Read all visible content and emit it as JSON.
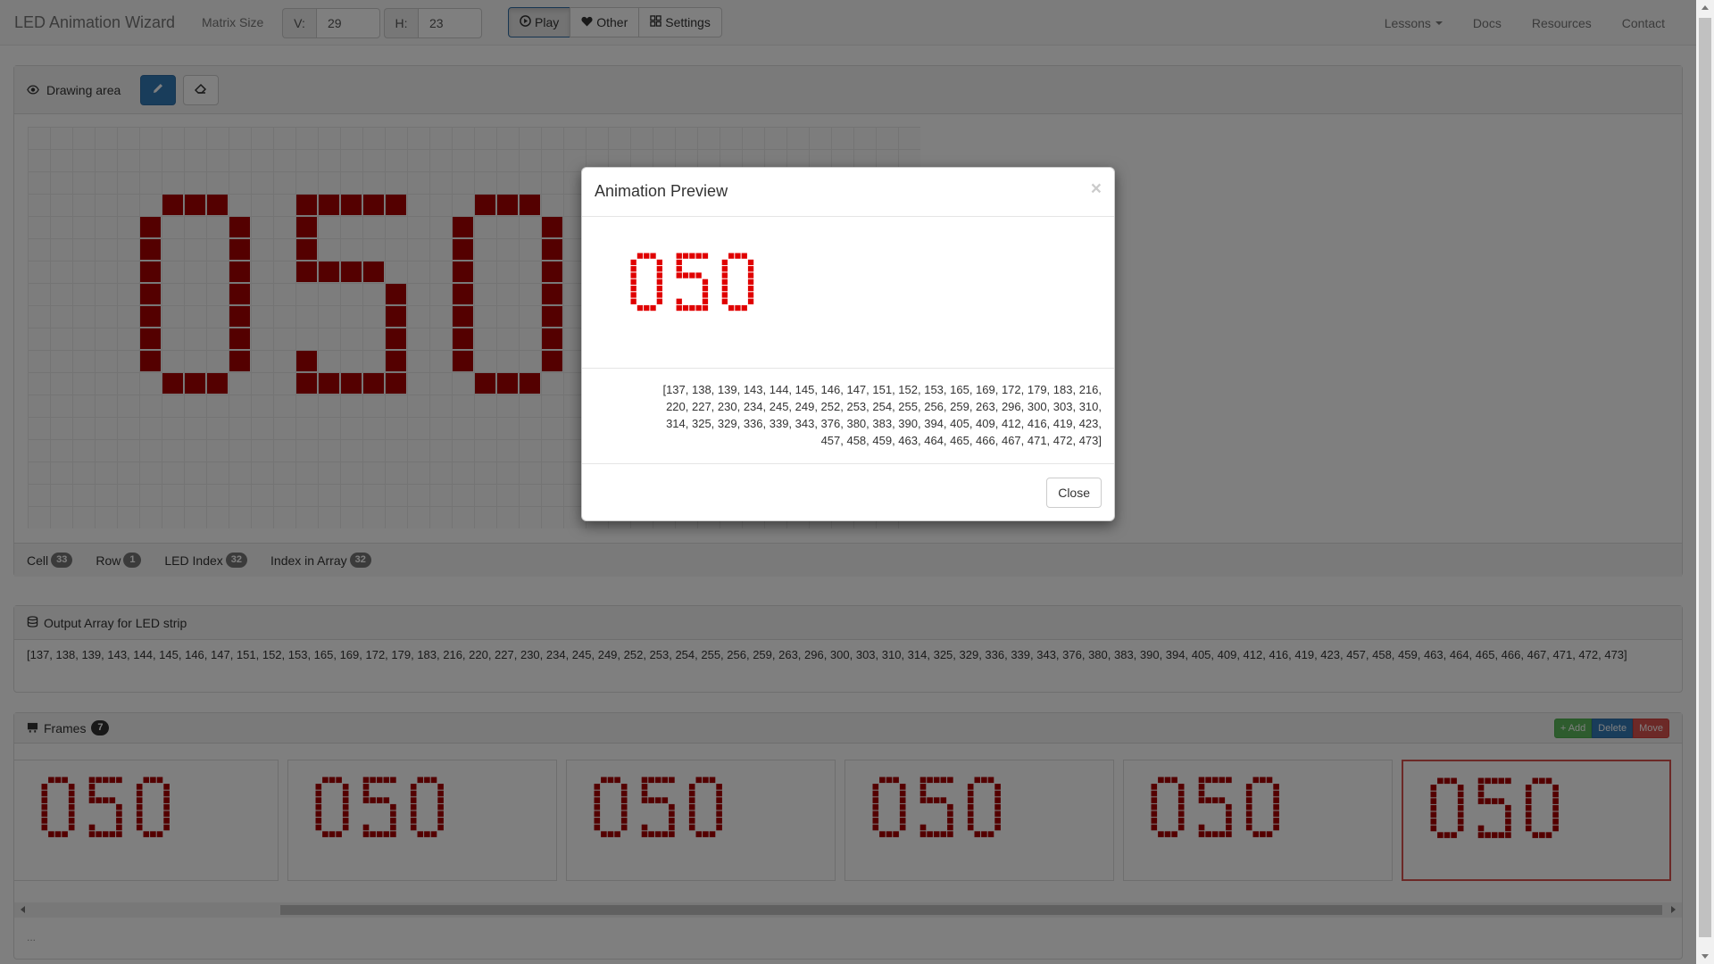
{
  "navbar": {
    "brand": "LED Animation Wizard",
    "matrix_label": "Matrix Size",
    "v_label": "V:",
    "v_value": "29",
    "h_label": "H:",
    "h_value": "23",
    "play_label": "Play",
    "other_label": "Other",
    "settings_label": "Settings",
    "links": [
      "Lessons",
      "Docs",
      "Resources",
      "Contact"
    ]
  },
  "drawing": {
    "heading": "Drawing area",
    "pixel_color": "#a80000",
    "digits": "050"
  },
  "status": {
    "cell_label": "Cell",
    "cell_value": "33",
    "row_label": "Row",
    "row_value": "1",
    "led_label": "LED Index",
    "led_value": "32",
    "array_label": "Index in Array",
    "array_value": "32"
  },
  "output": {
    "heading": "Output Array for LED strip",
    "array_text": "[137, 138, 139, 143, 144, 145, 146, 147, 151, 152, 153, 165, 169, 172, 179, 183, 216, 220, 227, 230, 234, 245, 249, 252, 253, 254, 255, 256, 259, 263, 296, 300, 303, 310, 314, 325, 329, 336, 339, 343, 376, 380, 383, 390, 394, 405, 409, 412, 416, 419, 423, 457, 458, 459, 463, 464, 465, 466, 467, 471, 472, 473]"
  },
  "frames": {
    "heading": "Frames",
    "count": "7",
    "add_label": "+ Add",
    "delete_label": "Delete",
    "move_label": "Move",
    "footer": "...",
    "pixel_color": "#a80000",
    "selected_index": 5
  },
  "modal": {
    "title": "Animation Preview",
    "close_x": "×",
    "preview_color": "#e00000",
    "array_lines": [
      "[137, 138, 139, 143, 144, 145, 146, 147, 151, 152, 153, 165, 169, 172, 179, 183, 216,",
      "220, 227, 230, 234, 245, 249, 252, 253, 254, 255, 256, 259, 263, 296, 300, 303, 310,",
      "314, 325, 329, 336, 339, 343, 376, 380, 383, 390, 394, 405, 409, 412, 416, 419, 423,",
      "457, 458, 459, 463, 464, 465, 466, 467, 471, 472, 473]"
    ],
    "close_label": "Close"
  }
}
